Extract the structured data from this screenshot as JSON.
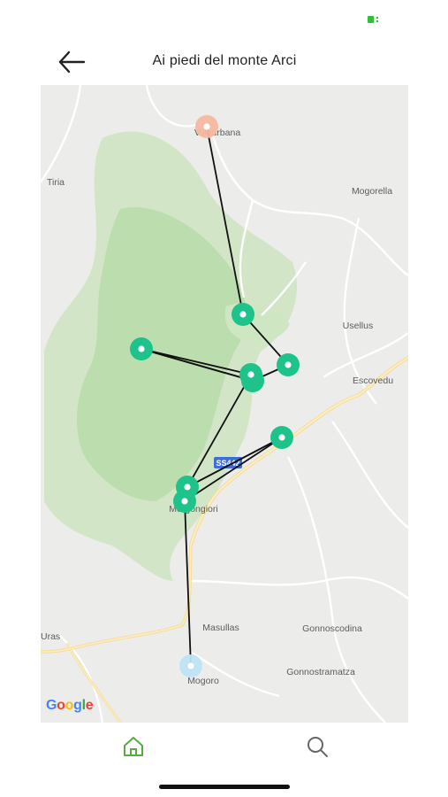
{
  "header": {
    "title": "Ai piedi del monte Arci"
  },
  "map": {
    "places": [
      {
        "key": "villaurbana",
        "name": "Villaurbana"
      },
      {
        "key": "tiria",
        "name": "Tiria"
      },
      {
        "key": "mogorella",
        "name": "Mogorella"
      },
      {
        "key": "usellus",
        "name": "Usellus"
      },
      {
        "key": "escovedu",
        "name": "Escovedu"
      },
      {
        "key": "morgongiori",
        "name": "Morgongiori"
      },
      {
        "key": "masullas",
        "name": "Masullas"
      },
      {
        "key": "gonnoscodina",
        "name": "Gonnoscodina"
      },
      {
        "key": "uras",
        "name": "Uras"
      },
      {
        "key": "gonnostramatza",
        "name": "Gonnostramatza"
      },
      {
        "key": "mogoro",
        "name": "Mogoro"
      }
    ],
    "road_badge": "SS442",
    "attribution": "Google",
    "route": {
      "start_color": "#f5b8a0",
      "waypoint_color": "#1ec28b",
      "end_color": "#bfe4f5",
      "line_color": "#111111",
      "stops": [
        {
          "type": "start",
          "near": "Villaurbana"
        },
        {
          "type": "waypoint"
        },
        {
          "type": "waypoint"
        },
        {
          "type": "waypoint"
        },
        {
          "type": "waypoint"
        },
        {
          "type": "waypoint"
        },
        {
          "type": "waypoint"
        },
        {
          "type": "waypoint",
          "near": "Morgongiori"
        },
        {
          "type": "waypoint",
          "near": "Morgongiori"
        },
        {
          "type": "end",
          "near": "Mogoro"
        }
      ]
    }
  },
  "tabs": [
    {
      "name": "home",
      "icon": "home-icon",
      "active": true,
      "active_color": "#5aab3c"
    },
    {
      "name": "search",
      "icon": "search-icon",
      "active": false
    }
  ],
  "status": {
    "battery_color": "#2fbf3a"
  }
}
